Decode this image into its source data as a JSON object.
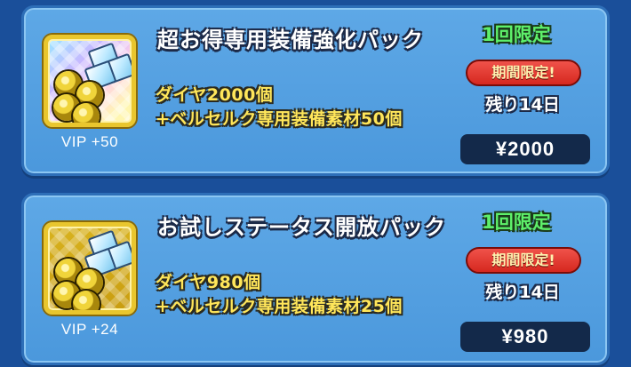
{
  "packs": [
    {
      "title": "超お得専用装備強化パック",
      "vip": "VIP +50",
      "line1": "ダイヤ2000個",
      "line2": "+ベルセルク専用装備素材50個",
      "limit": "1回限定",
      "period_badge": "期間限定!",
      "remaining": "残り14日",
      "price": "¥2000"
    },
    {
      "title": "お試しステータス開放パック",
      "vip": "VIP +24",
      "line1": "ダイヤ980個",
      "line2": "+ベルセルク専用装備素材25個",
      "limit": "1回限定",
      "period_badge": "期間限定!",
      "remaining": "残り14日",
      "price": "¥980"
    }
  ],
  "colors": {
    "background": "#1a4f9a",
    "card": "#4b98dc",
    "limit_text": "#5ef06a",
    "description_text": "#ffe65a",
    "period_badge": "#d6281f",
    "price_button": "#13294a"
  },
  "icons": [
    "gold-coins-icon",
    "diamond-crystals-icon"
  ]
}
